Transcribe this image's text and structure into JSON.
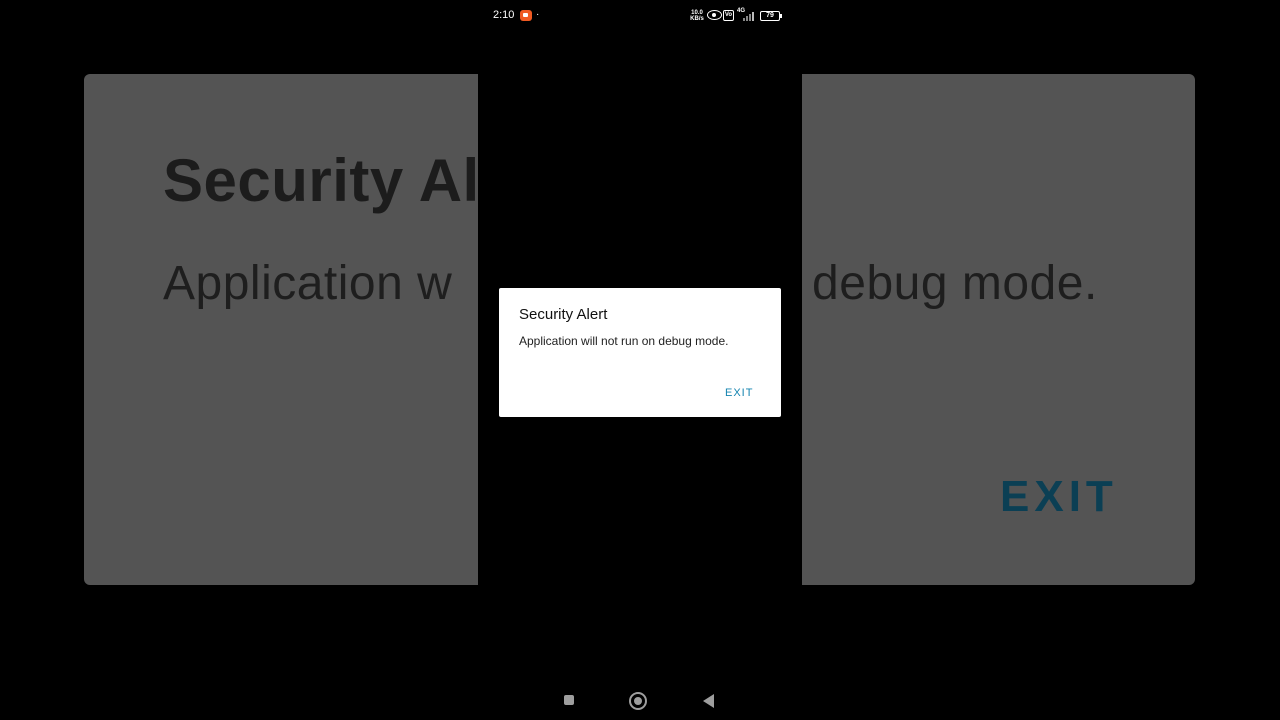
{
  "status_bar": {
    "time": "2:10",
    "dot": "·",
    "net_speed_value": "10.0",
    "net_speed_unit": "KB/s",
    "vo_label": "Vo",
    "network_type": "4G",
    "battery_level": "79"
  },
  "background_zoom": {
    "title": "Security Al",
    "message": "Application w                          debug mode.",
    "exit_label": "EXIT"
  },
  "dialog": {
    "title": "Security Alert",
    "message": "Application will not run on debug mode.",
    "exit_label": "EXIT"
  },
  "colors": {
    "accent": "#1584b0",
    "record_indicator": "#f05a22"
  },
  "icons": {
    "record": "screen-record-icon",
    "eye": "eye-icon",
    "volte": "volte-icon",
    "signal": "signal-bars-icon",
    "battery": "battery-icon",
    "recents": "recents-square-icon",
    "home": "home-circle-icon",
    "back": "back-triangle-icon"
  }
}
